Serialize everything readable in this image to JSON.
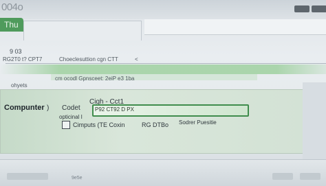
{
  "app": {
    "brand": "004o",
    "active_tab": "Thu"
  },
  "header": {
    "count": "9 03"
  },
  "rows": [
    {
      "left": "RG2T0 t? CPT7",
      "middle": "Choeclesuttion cgn CTT",
      "right": "<"
    },
    {
      "left": "ohyets",
      "middle": "cm ocodl Gpnsceet: 2eiP e3 1ba"
    }
  ],
  "panel": {
    "label": "Compunter",
    "paren": ")",
    "code_label": "Codet",
    "code_value": "Cigh - Cct1",
    "input_value": "P92 CT92 D PX",
    "left_text": "opticinal I",
    "checkbox_label": "Cimputs (TE Coxin",
    "value_2": "RG DTBo",
    "value_3": "Sodrer Puesitie"
  },
  "status": "9e5e"
}
